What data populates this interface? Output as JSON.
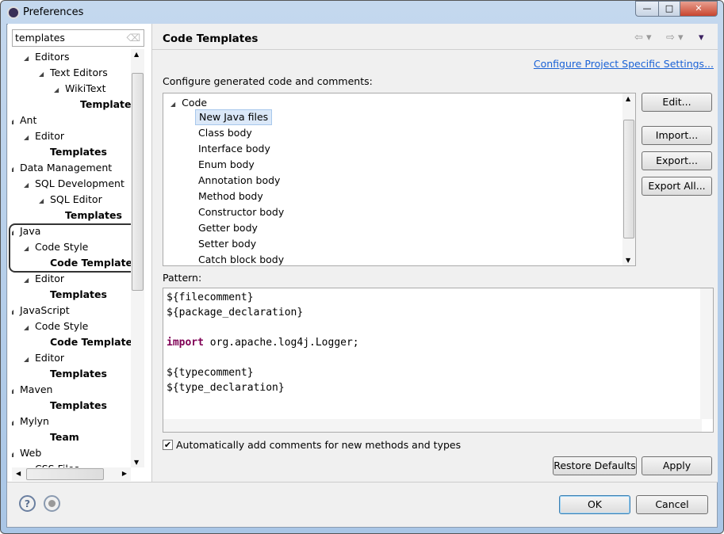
{
  "window": {
    "title": "Preferences",
    "minimize": "—",
    "maximize": "□",
    "close": "✕"
  },
  "search": {
    "value": "templates"
  },
  "tree": [
    {
      "label": "Editors",
      "level": 1,
      "bold": false,
      "arrow": true
    },
    {
      "label": "Text Editors",
      "level": 2,
      "bold": false,
      "arrow": true
    },
    {
      "label": "WikiText",
      "level": 3,
      "bold": false,
      "arrow": true
    },
    {
      "label": "Templates",
      "level": 4,
      "bold": true,
      "arrow": false
    },
    {
      "label": "Ant",
      "level": 0,
      "bold": false,
      "arrow": true
    },
    {
      "label": "Editor",
      "level": 1,
      "bold": false,
      "arrow": true
    },
    {
      "label": "Templates",
      "level": 2,
      "bold": true,
      "arrow": false
    },
    {
      "label": "Data Management",
      "level": 0,
      "bold": false,
      "arrow": true
    },
    {
      "label": "SQL Development",
      "level": 1,
      "bold": false,
      "arrow": true
    },
    {
      "label": "SQL Editor",
      "level": 2,
      "bold": false,
      "arrow": true
    },
    {
      "label": "Templates",
      "level": 3,
      "bold": true,
      "arrow": false
    },
    {
      "label": "Java",
      "level": 0,
      "bold": false,
      "arrow": true
    },
    {
      "label": "Code Style",
      "level": 1,
      "bold": false,
      "arrow": true
    },
    {
      "label": "Code Templates",
      "level": 2,
      "bold": true,
      "arrow": false,
      "selected": true
    },
    {
      "label": "Editor",
      "level": 1,
      "bold": false,
      "arrow": true
    },
    {
      "label": "Templates",
      "level": 2,
      "bold": true,
      "arrow": false
    },
    {
      "label": "JavaScript",
      "level": 0,
      "bold": false,
      "arrow": true
    },
    {
      "label": "Code Style",
      "level": 1,
      "bold": false,
      "arrow": true
    },
    {
      "label": "Code Templates",
      "level": 2,
      "bold": true,
      "arrow": false
    },
    {
      "label": "Editor",
      "level": 1,
      "bold": false,
      "arrow": true
    },
    {
      "label": "Templates",
      "level": 2,
      "bold": true,
      "arrow": false
    },
    {
      "label": "Maven",
      "level": 0,
      "bold": false,
      "arrow": true
    },
    {
      "label": "Templates",
      "level": 2,
      "bold": true,
      "arrow": false
    },
    {
      "label": "Mylyn",
      "level": 0,
      "bold": false,
      "arrow": true
    },
    {
      "label": "Team",
      "level": 2,
      "bold": true,
      "arrow": false
    },
    {
      "label": "Web",
      "level": 0,
      "bold": false,
      "arrow": true
    },
    {
      "label": "CSS Files",
      "level": 1,
      "bold": false,
      "arrow": false
    }
  ],
  "page": {
    "title": "Code Templates",
    "link": "Configure Project Specific Settings...",
    "configure_label": "Configure generated code and comments:",
    "pattern_label": "Pattern:"
  },
  "templates": {
    "group": "Code",
    "items": [
      "New Java files",
      "Class body",
      "Interface body",
      "Enum body",
      "Annotation body",
      "Method body",
      "Constructor body",
      "Getter body",
      "Setter body",
      "Catch block body"
    ],
    "selected": "New Java files"
  },
  "buttons": {
    "edit": "Edit...",
    "import": "Import...",
    "export": "Export...",
    "export_all": "Export All...",
    "restore": "Restore Defaults",
    "apply": "Apply",
    "ok": "OK",
    "cancel": "Cancel"
  },
  "pattern": {
    "l1": "${filecomment}",
    "l2": "${package_declaration}",
    "l4_kw": "import",
    "l4_rest": " org.apache.log4j.Logger;",
    "l6": "${typecomment}",
    "l7": "${type_declaration}"
  },
  "checkbox": {
    "label": "Automatically add comments for new methods and types",
    "checked": true
  },
  "colors": {
    "link": "#1a62d6",
    "keyword": "#7f0055",
    "selection": "#dbe8f8"
  }
}
